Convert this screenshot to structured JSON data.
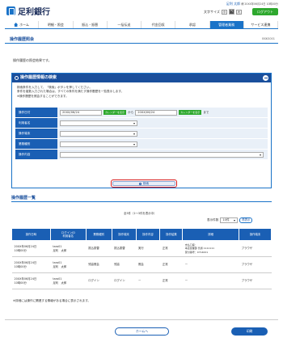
{
  "header": {
    "bank_name": "足利銀行",
    "user_name": "足利 太郎",
    "user_suffix": "様",
    "last_login": "20XX年06月24日 10時00分",
    "font_size_label": "文字サイズ",
    "font_sizes": [
      "小",
      "中",
      "大"
    ],
    "font_size_selected": "中",
    "logout_label": "ログアウト"
  },
  "nav": {
    "items": [
      "ホーム",
      "明細・照会",
      "振込・振替",
      "一括伝送",
      "代金回収",
      "承認",
      "管理者業務",
      "サービス連携"
    ],
    "active": "管理者業務"
  },
  "page": {
    "title": "操作履歴照会",
    "code": "BSKS001",
    "intro": "操作履歴の照会結果です。"
  },
  "search_panel": {
    "title": "操作履歴情報の検索",
    "notes": [
      "検索条件を入力して、「検索」ボタンを押してください。",
      "条件を複数入力された場合は、すべての条件を満たす操作履歴を一覧表示します。",
      "※操作履歴を照会することができます。"
    ],
    "fields": {
      "date_label": "操作日付",
      "date_from": "20XX/06/24",
      "date_to": "20XX/06/24",
      "calendar_label": "カレンダーを表示",
      "from_sep": "から",
      "to_sep": "まで",
      "user_label": "利用者名",
      "terminal_label": "操作端末",
      "category_label": "業務種別",
      "content_label": "操作内容"
    },
    "search_button": "検索"
  },
  "list": {
    "title": "操作履歴一覧",
    "count": "全3件（1〜3件を表示中）",
    "per_page_label": "表示件数",
    "per_page": "10件",
    "redisplay": "再表示",
    "columns": [
      "操作日時",
      "ログインID\n利用者名",
      "業務種別",
      "操作端末",
      "操作内容",
      "操作結果",
      "詳細",
      "操作端末"
    ],
    "rows": [
      [
        "20XX年06月24日\n10時00分",
        "taro01\n足利　太郎",
        "振込振替",
        "振込振替",
        "実行",
        "正常",
        "支払口座：\n本店営業部 普通 1111111\n受付番号：0714001",
        "ブラウザ"
      ],
      [
        "20XX年06月24日\n10時00分",
        "taro01\n足利　太郎",
        "残高照会",
        "残高",
        "照会",
        "正常",
        "ー",
        "ブラウザ"
      ],
      [
        "20XX年06月24日\n10時00分",
        "taro01\n足利　太郎",
        "ログイン",
        "ログイン",
        "ー",
        "正常",
        "ー",
        "ブラウザ"
      ]
    ],
    "footnote": "※詳細には操作に関連する情報がある場合に表示されます。"
  },
  "footer": {
    "home_button": "ホームへ",
    "print_button": "印刷"
  }
}
